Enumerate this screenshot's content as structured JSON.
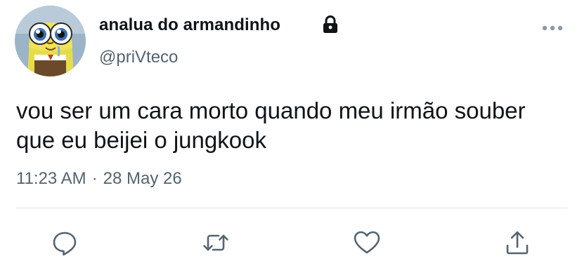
{
  "tweet": {
    "display_name": "analua do armandinho",
    "handle": "@priVteco",
    "text": "vou ser um cara morto quando meu irmão souber que eu beijei o jungkook",
    "time": "11:23 AM",
    "separator": "·",
    "date": "28 May 26",
    "account_locked": true
  },
  "icons": {
    "avatar": "cartoon-avatar",
    "lock": "lock-icon",
    "more": "more-icon",
    "reply": "reply-icon",
    "retweet": "retweet-icon",
    "like": "heart-icon",
    "share": "share-icon"
  },
  "colors": {
    "text_primary": "#0f1419",
    "text_secondary": "#536471",
    "divider": "#e1e6ea",
    "icon": "#536471"
  }
}
